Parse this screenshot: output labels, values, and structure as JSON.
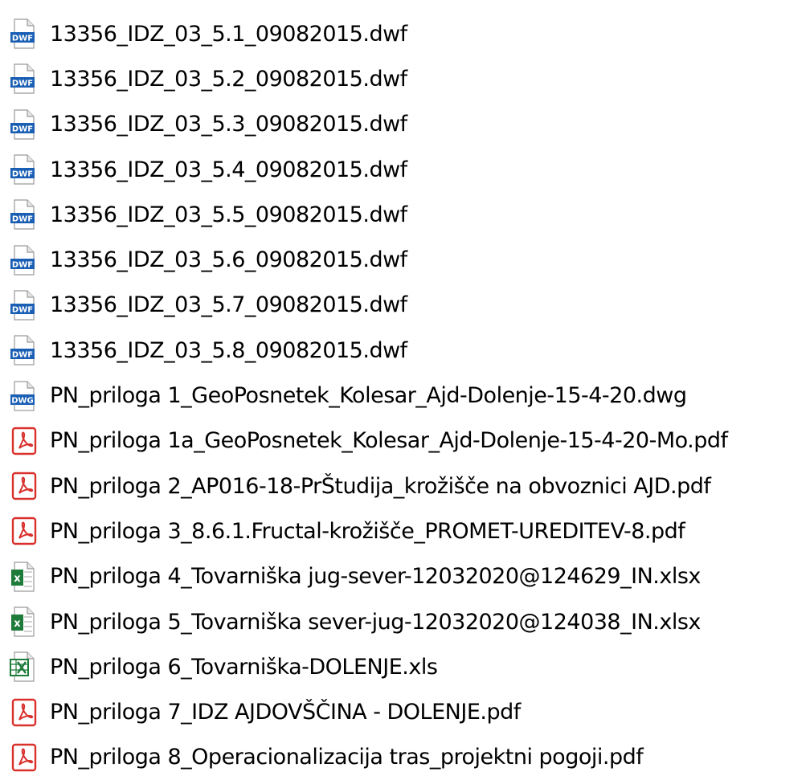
{
  "files": [
    {
      "name": "13356_IDZ_03_5.1_09082015.dwf",
      "icon": "dwf-file-icon"
    },
    {
      "name": "13356_IDZ_03_5.2_09082015.dwf",
      "icon": "dwf-file-icon"
    },
    {
      "name": "13356_IDZ_03_5.3_09082015.dwf",
      "icon": "dwf-file-icon"
    },
    {
      "name": "13356_IDZ_03_5.4_09082015.dwf",
      "icon": "dwf-file-icon"
    },
    {
      "name": "13356_IDZ_03_5.5_09082015.dwf",
      "icon": "dwf-file-icon"
    },
    {
      "name": "13356_IDZ_03_5.6_09082015.dwf",
      "icon": "dwf-file-icon"
    },
    {
      "name": "13356_IDZ_03_5.7_09082015.dwf",
      "icon": "dwf-file-icon"
    },
    {
      "name": "13356_IDZ_03_5.8_09082015.dwf",
      "icon": "dwf-file-icon"
    },
    {
      "name": "PN_priloga 1_GeoPosnetek_Kolesar_Ajd-Dolenje-15-4-20.dwg",
      "icon": "dwg-file-icon"
    },
    {
      "name": "PN_priloga 1a_GeoPosnetek_Kolesar_Ajd-Dolenje-15-4-20-Mo.pdf",
      "icon": "pdf-file-icon"
    },
    {
      "name": "PN_priloga 2_AP016-18-PrŠtudija_krožišče na obvoznici AJD.pdf",
      "icon": "pdf-file-icon"
    },
    {
      "name": "PN_priloga 3_8.6.1.Fructal-krožišče_PROMET-UREDITEV-8.pdf",
      "icon": "pdf-file-icon"
    },
    {
      "name": "PN_priloga 4_Tovarniška jug-sever-12032020@124629_IN.xlsx",
      "icon": "xlsx-file-icon"
    },
    {
      "name": "PN_priloga 5_Tovarniška sever-jug-12032020@124038_IN.xlsx",
      "icon": "xlsx-file-icon"
    },
    {
      "name": "PN_priloga 6_Tovarniška-DOLENJE.xls",
      "icon": "xls-file-icon"
    },
    {
      "name": "PN_priloga 7_IDZ AJDOVŠČINA - DOLENJE.pdf",
      "icon": "pdf-file-icon"
    },
    {
      "name": "PN_priloga 8_Operacionalizacija tras_projektni pogoji.pdf",
      "icon": "pdf-file-icon"
    }
  ],
  "colors": {
    "dwf_blue": "#1a5fb4",
    "pdf_red": "#d9302c",
    "excel_green": "#1e7b3a"
  }
}
